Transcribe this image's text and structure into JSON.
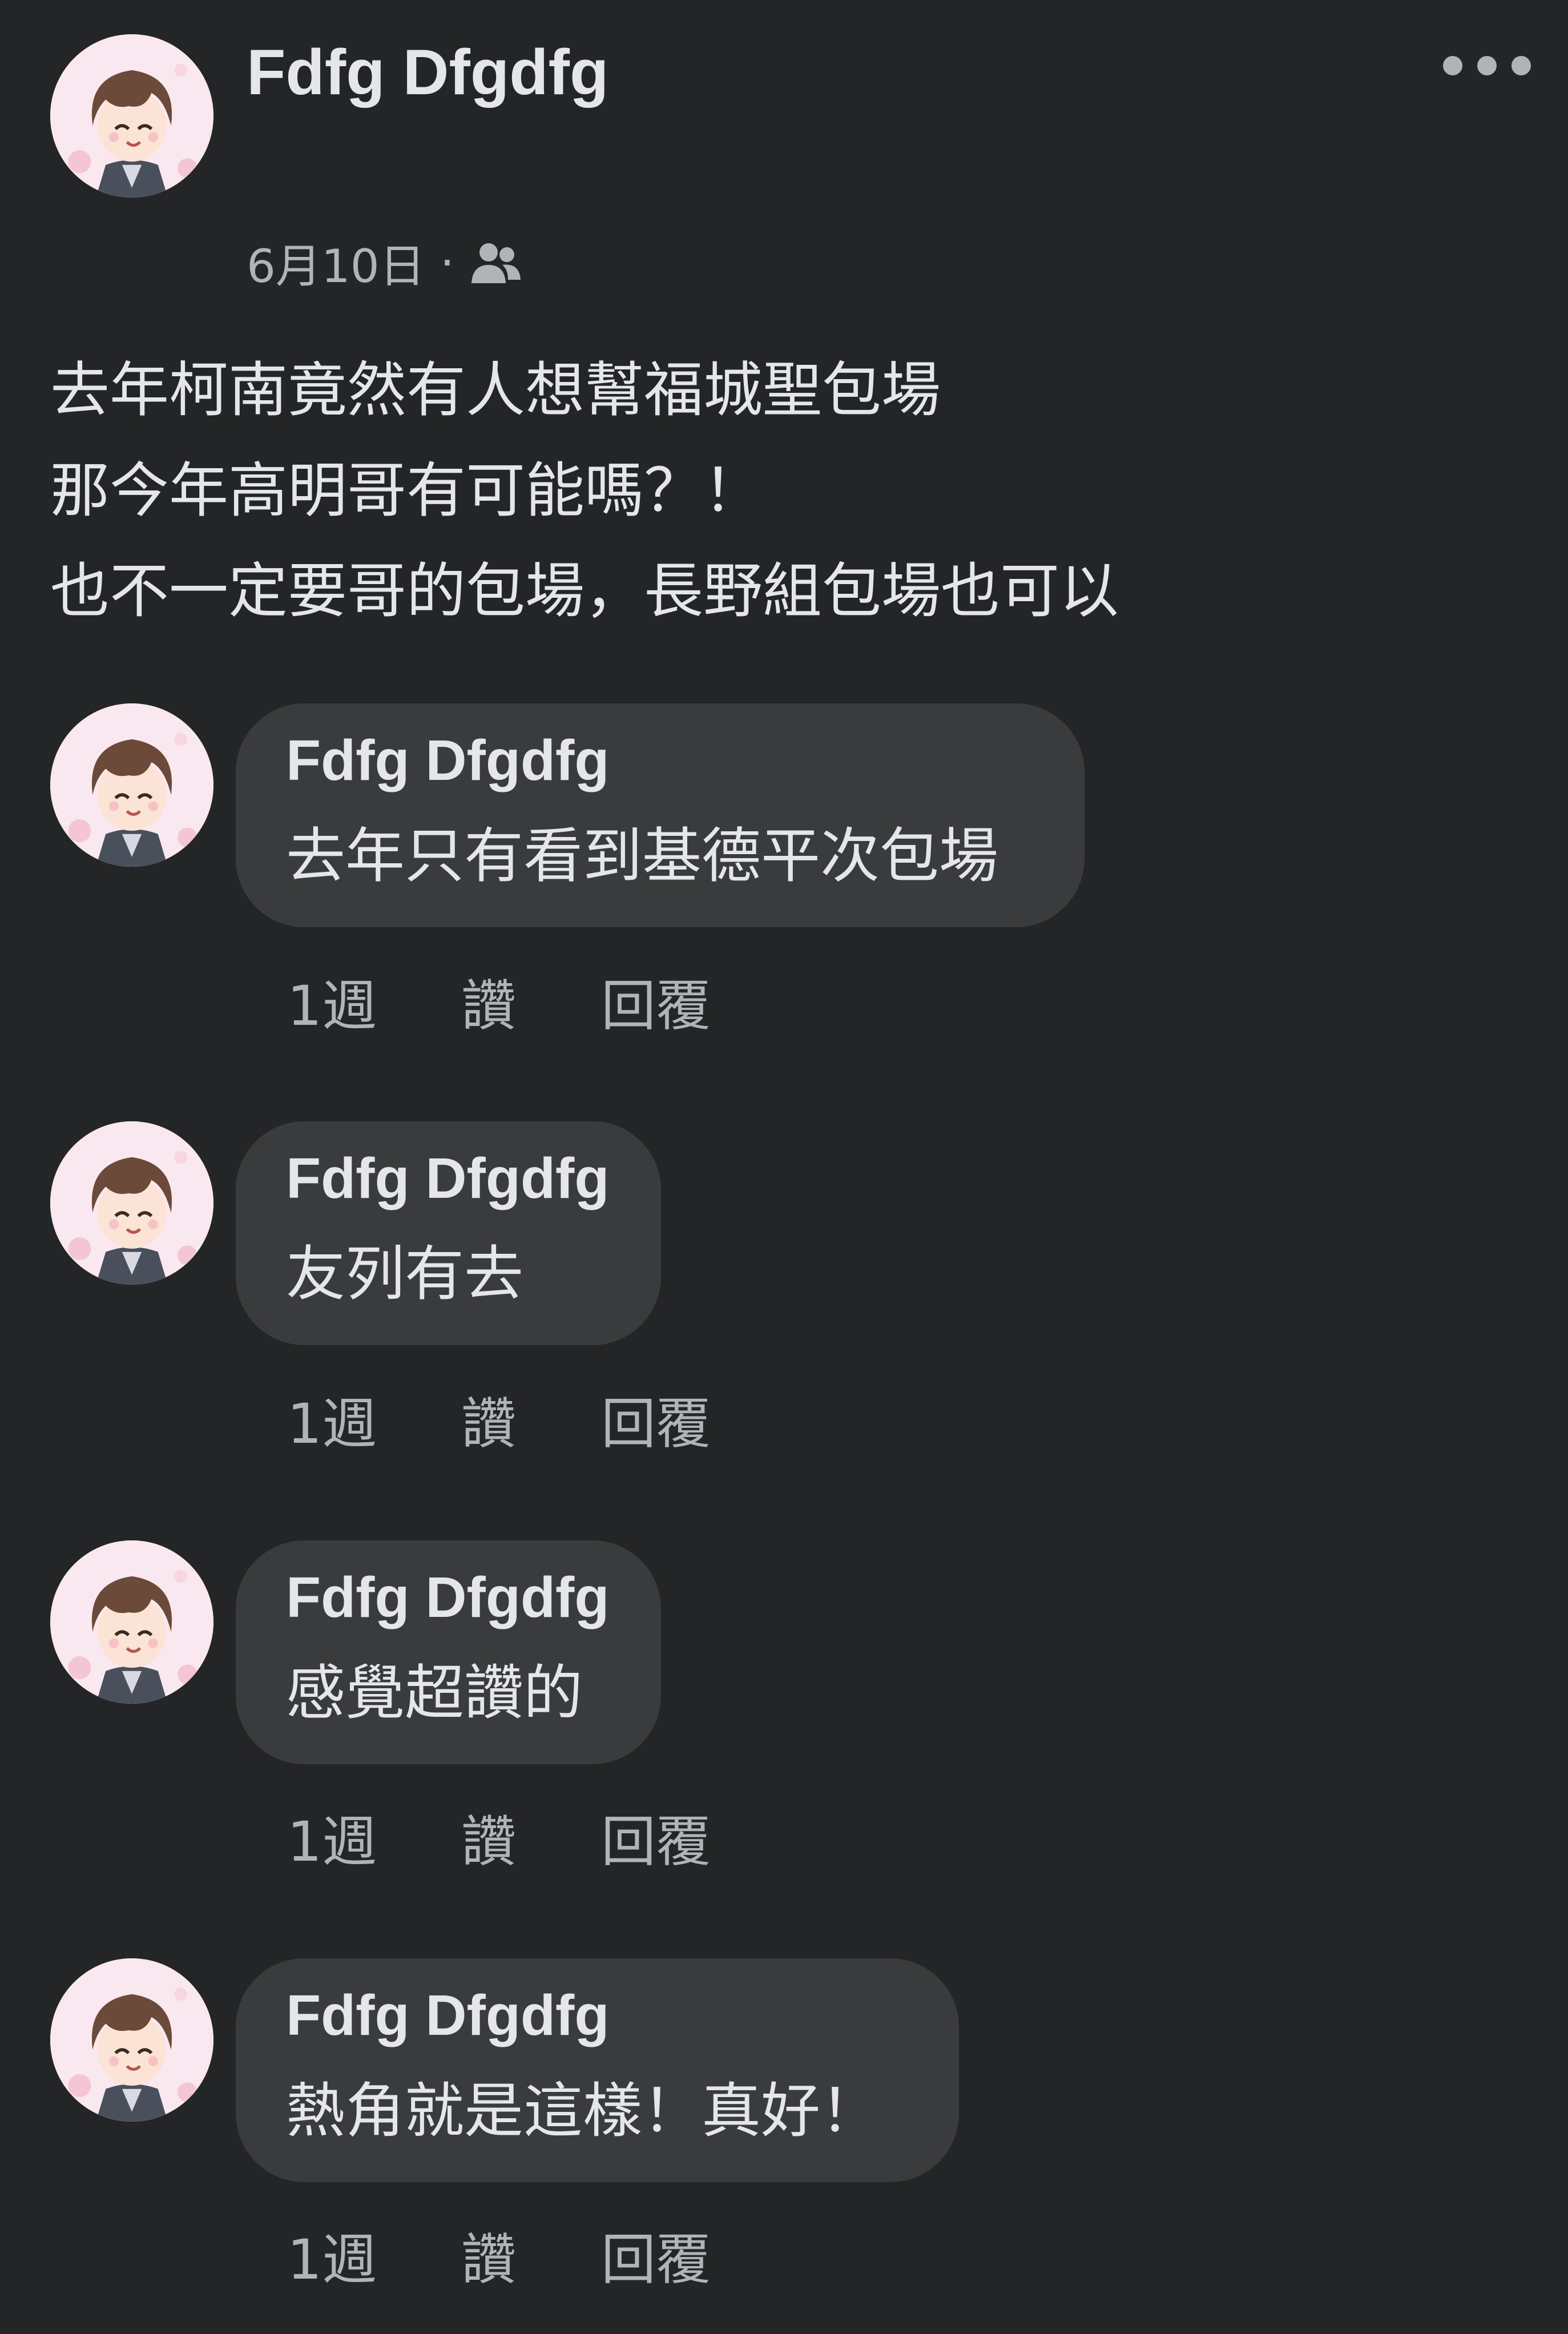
{
  "post": {
    "author": "Fdfg Dfgdfg",
    "date": "6月10日",
    "separator": "·",
    "audience_icon": "friends-icon",
    "more_icon": "more-options-icon",
    "lines": [
      "去年柯南竟然有人想幫福城聖包場",
      "那今年高明哥有可能嗎？！",
      "也不一定要哥的包場，長野組包場也可以"
    ]
  },
  "comments": [
    {
      "author": "Fdfg Dfgdfg",
      "text": "去年只有看到基德平次包場",
      "time": "1週",
      "like": "讚",
      "reply": "回覆"
    },
    {
      "author": "Fdfg Dfgdfg",
      "text": "友列有去",
      "time": "1週",
      "like": "讚",
      "reply": "回覆"
    },
    {
      "author": "Fdfg Dfgdfg",
      "text": "感覺超讚的",
      "time": "1週",
      "like": "讚",
      "reply": "回覆"
    },
    {
      "author": "Fdfg Dfgdfg",
      "text": "熱角就是這樣！真好！",
      "time": "1週",
      "like": "讚",
      "reply": "回覆"
    }
  ],
  "colors": {
    "background": "#242526",
    "bubble": "#3a3b3c",
    "primary_text": "#e4e6eb",
    "secondary_text": "#b0b3b8"
  }
}
